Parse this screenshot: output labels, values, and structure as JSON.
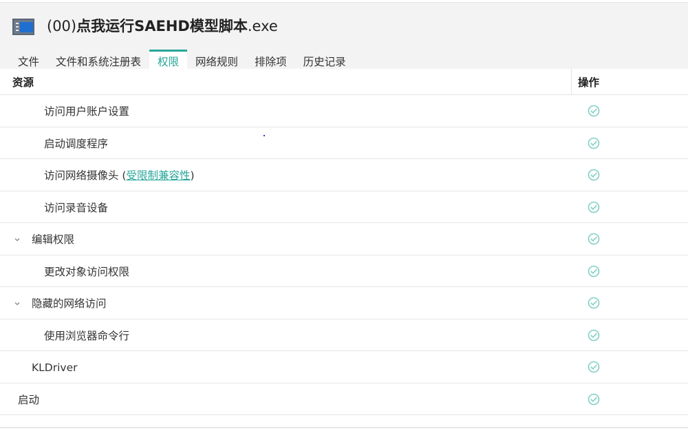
{
  "window": {
    "title_prefix": "(00)",
    "title_bold": "点我运行SAEHD模型脚本",
    "title_suffix": ".exe",
    "icon": "application-window-icon"
  },
  "tabs": [
    {
      "label": "文件",
      "active": false
    },
    {
      "label": "文件和系统注册表",
      "active": false
    },
    {
      "label": "权限",
      "active": true
    },
    {
      "label": "网络规则",
      "active": false
    },
    {
      "label": "排除项",
      "active": false
    },
    {
      "label": "历史记录",
      "active": false
    }
  ],
  "table": {
    "col_resource": "资源",
    "col_action": "操作",
    "rows": [
      {
        "label": "访问用户账户设置",
        "level": 2,
        "action_icon": "check-circle-icon"
      },
      {
        "label": "启动调度程序",
        "level": 2,
        "action_icon": "check-circle-icon"
      },
      {
        "label": "访问网络摄像头 (",
        "link": "受限制兼容性",
        "label_after": ")",
        "level": 2,
        "action_icon": "check-circle-icon"
      },
      {
        "label": "访问录音设备",
        "level": 2,
        "action_icon": "check-circle-icon"
      },
      {
        "label": "编辑权限",
        "level": 1,
        "expanded": true,
        "action_icon": "check-circle-icon"
      },
      {
        "label": "更改对象访问权限",
        "level": 2,
        "action_icon": "check-circle-icon"
      },
      {
        "label": "隐藏的网络访问",
        "level": 1,
        "expanded": true,
        "action_icon": "check-circle-icon"
      },
      {
        "label": "使用浏览器命令行",
        "level": 2,
        "action_icon": "check-circle-icon"
      },
      {
        "label": "KLDriver",
        "level": 1,
        "action_icon": "check-circle-icon"
      },
      {
        "label": "启动",
        "level": 0,
        "action_icon": "check-circle-icon"
      }
    ]
  },
  "colors": {
    "accent": "#26a69a",
    "header_bg": "#f3f3f3",
    "check": "#7fd1c6"
  }
}
